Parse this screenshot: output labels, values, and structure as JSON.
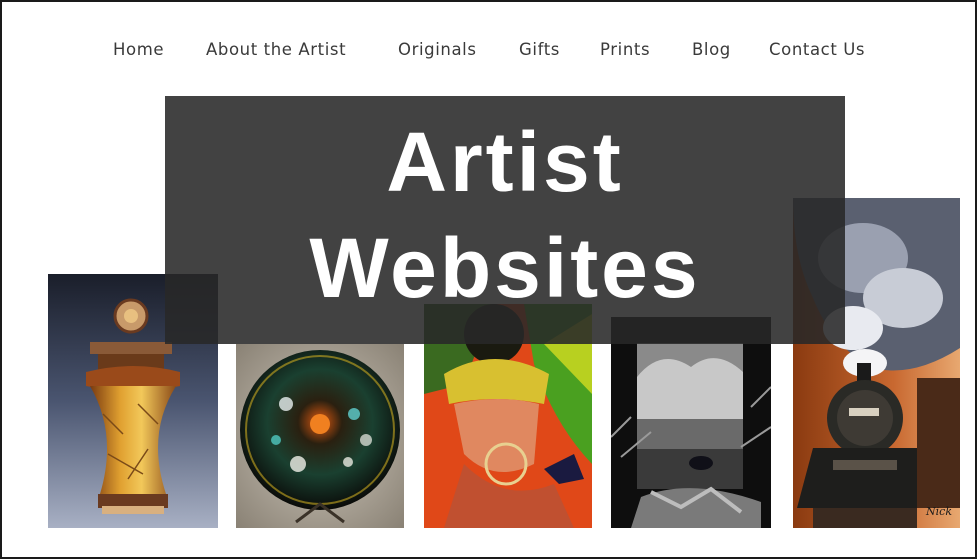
{
  "nav": {
    "items": [
      {
        "label": "Home"
      },
      {
        "label": "About the Artist"
      },
      {
        "label": "Originals"
      },
      {
        "label": "Gifts"
      },
      {
        "label": "Prints"
      },
      {
        "label": "Blog"
      },
      {
        "label": "Contact Us"
      }
    ]
  },
  "hero": {
    "line1": "Artist",
    "line2": "Websites"
  },
  "gallery": {
    "items": [
      {
        "subject": "raku-vase"
      },
      {
        "subject": "glass-plate"
      },
      {
        "subject": "woman-portrait"
      },
      {
        "subject": "raven-landscape"
      },
      {
        "subject": "steam-train"
      }
    ]
  },
  "art_signature": "Nick",
  "colors": {
    "page_bg": "#ffffff",
    "border": "#1a1a1a",
    "nav_text": "#3a3a3a",
    "banner_bg": "#282828",
    "banner_text": "#ffffff"
  }
}
